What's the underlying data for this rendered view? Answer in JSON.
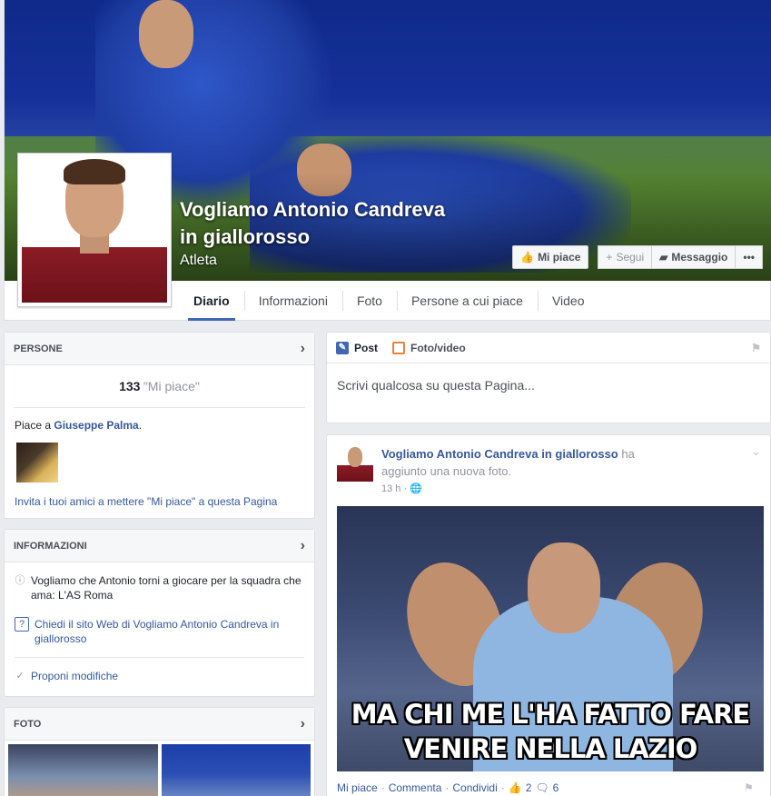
{
  "page": {
    "name_line1": "Vogliamo Antonio Candreva",
    "name_line2": "in giallorosso",
    "category": "Atleta"
  },
  "cover_buttons": {
    "like": "Mi piace",
    "follow": "Segui",
    "message": "Messaggio",
    "more": "•••"
  },
  "tabs": [
    "Diario",
    "Informazioni",
    "Foto",
    "Persone a cui piace",
    "Video"
  ],
  "people": {
    "title": "PERSONE",
    "count": "133",
    "count_label": "\"Mi piace\"",
    "liked_prefix": "Piace a ",
    "liked_name": "Giuseppe Palma",
    "liked_suffix": ".",
    "invite": "Invita i tuoi amici a mettere \"Mi piace\" a questa Pagina"
  },
  "info": {
    "title": "INFORMAZIONI",
    "description": "Vogliamo che Antonio torni a giocare per la squadra che ama: L'AS Roma",
    "ask_website": "Chiedi il sito Web di Vogliamo Antonio Candreva in giallorosso",
    "suggest_edits": "Proponi modifiche"
  },
  "photos": {
    "title": "FOTO"
  },
  "composer": {
    "tab_post": "Post",
    "tab_photo": "Foto/video",
    "placeholder": "Scrivi qualcosa su questa Pagina..."
  },
  "post": {
    "author": "Vogliamo Antonio Candreva in giallorosso",
    "action_1": " ha",
    "action_2": "aggiunto una nuova foto.",
    "time": "13 h",
    "caption_line1": "MA CHI ME L'HA FATTO FARE",
    "caption_line2": "VENIRE NELLA LAZIO",
    "like": "Mi piace",
    "comment": "Commenta",
    "share": "Condividi",
    "like_count": "2",
    "comment_count": "6"
  },
  "colors": {
    "accent": "#4267b2",
    "link": "#365899",
    "background": "#e9ebee"
  }
}
